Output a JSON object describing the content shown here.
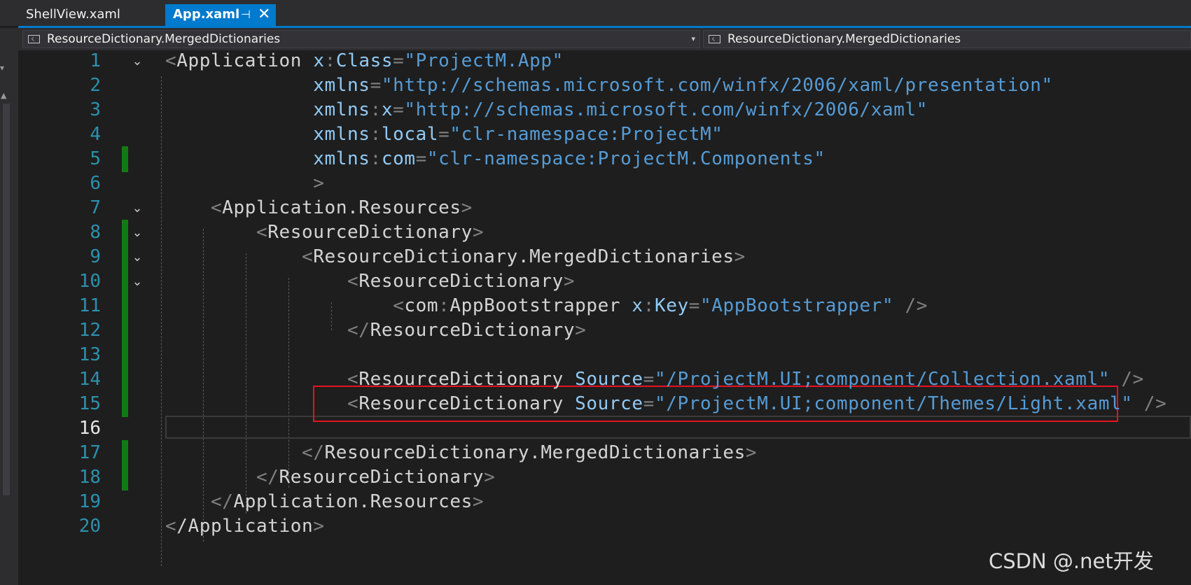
{
  "tabs": {
    "inactive_label": "ShellView.xaml",
    "active_label": "App.xaml",
    "pin_glyph": "⊣",
    "close_glyph": "✕"
  },
  "navbar": {
    "left_scope": "ResourceDictionary.MergedDictionaries",
    "right_scope": "ResourceDictionary.MergedDictionaries",
    "dropdown_glyph": "▾"
  },
  "editor": {
    "current_line": 16,
    "lines": [
      {
        "n": "1",
        "tokens": [
          [
            "br",
            "<"
          ],
          [
            "el",
            "Application "
          ],
          [
            "an",
            "x"
          ],
          [
            "op",
            ":"
          ],
          [
            "an",
            "Class"
          ],
          [
            "op",
            "="
          ],
          [
            "av",
            "\"ProjectM.App\""
          ]
        ]
      },
      {
        "n": "2",
        "tokens": [
          [
            "an",
            "             xmlns"
          ],
          [
            "op",
            "="
          ],
          [
            "av",
            "\"http://schemas.microsoft.com/winfx/2006/xaml/presentation\""
          ]
        ]
      },
      {
        "n": "3",
        "tokens": [
          [
            "an",
            "             xmlns"
          ],
          [
            "op",
            ":"
          ],
          [
            "an",
            "x"
          ],
          [
            "op",
            "="
          ],
          [
            "av",
            "\"http://schemas.microsoft.com/winfx/2006/xaml\""
          ]
        ]
      },
      {
        "n": "4",
        "tokens": [
          [
            "an",
            "             xmlns"
          ],
          [
            "op",
            ":"
          ],
          [
            "an",
            "local"
          ],
          [
            "op",
            "="
          ],
          [
            "av",
            "\"clr-namespace:ProjectM\""
          ]
        ]
      },
      {
        "n": "5",
        "tokens": [
          [
            "an",
            "             xmlns"
          ],
          [
            "op",
            ":"
          ],
          [
            "an",
            "com"
          ],
          [
            "op",
            "="
          ],
          [
            "av",
            "\"clr-namespace:ProjectM.Components\""
          ]
        ]
      },
      {
        "n": "6",
        "tokens": [
          [
            "br",
            "             >"
          ]
        ]
      },
      {
        "n": "7",
        "tokens": [
          [
            "br",
            "    <"
          ],
          [
            "el",
            "Application.Resources"
          ],
          [
            "br",
            ">"
          ]
        ]
      },
      {
        "n": "8",
        "tokens": [
          [
            "br",
            "        <"
          ],
          [
            "el",
            "ResourceDictionary"
          ],
          [
            "br",
            ">"
          ]
        ]
      },
      {
        "n": "9",
        "tokens": [
          [
            "br",
            "            <"
          ],
          [
            "el",
            "ResourceDictionary.MergedDictionaries"
          ],
          [
            "br",
            ">"
          ]
        ]
      },
      {
        "n": "10",
        "tokens": [
          [
            "br",
            "                <"
          ],
          [
            "el",
            "ResourceDictionary"
          ],
          [
            "br",
            ">"
          ]
        ]
      },
      {
        "n": "11",
        "tokens": [
          [
            "br",
            "                    <"
          ],
          [
            "el",
            "com"
          ],
          [
            "op",
            ":"
          ],
          [
            "el",
            "AppBootstrapper "
          ],
          [
            "an",
            "x"
          ],
          [
            "op",
            ":"
          ],
          [
            "an",
            "Key"
          ],
          [
            "op",
            "="
          ],
          [
            "av",
            "\"AppBootstrapper\""
          ],
          [
            "br",
            " />"
          ]
        ]
      },
      {
        "n": "12",
        "tokens": [
          [
            "br",
            "                </"
          ],
          [
            "el",
            "ResourceDictionary"
          ],
          [
            "br",
            ">"
          ]
        ]
      },
      {
        "n": "13",
        "tokens": []
      },
      {
        "n": "14",
        "tokens": [
          [
            "br",
            "                <"
          ],
          [
            "el",
            "ResourceDictionary "
          ],
          [
            "an",
            "Source"
          ],
          [
            "op",
            "="
          ],
          [
            "av",
            "\"/ProjectM.UI;component/Collection.xaml\""
          ],
          [
            "br",
            " />"
          ]
        ]
      },
      {
        "n": "15",
        "tokens": [
          [
            "br",
            "                <"
          ],
          [
            "el",
            "ResourceDictionary "
          ],
          [
            "an",
            "Source"
          ],
          [
            "op",
            "="
          ],
          [
            "av",
            "\"/ProjectM.UI;component/Themes/Light.xaml\""
          ],
          [
            "br",
            " />"
          ]
        ]
      },
      {
        "n": "16",
        "tokens": []
      },
      {
        "n": "17",
        "tokens": [
          [
            "br",
            "            </"
          ],
          [
            "el",
            "ResourceDictionary.MergedDictionaries"
          ],
          [
            "br",
            ">"
          ]
        ]
      },
      {
        "n": "18",
        "tokens": [
          [
            "br",
            "        </"
          ],
          [
            "el",
            "ResourceDictionary"
          ],
          [
            "br",
            ">"
          ]
        ]
      },
      {
        "n": "19",
        "tokens": [
          [
            "br",
            "    </"
          ],
          [
            "el",
            "Application.Resources"
          ],
          [
            "br",
            ">"
          ]
        ]
      },
      {
        "n": "20",
        "tokens": [
          [
            "br",
            "<"
          ],
          [
            "el",
            "/Application"
          ],
          [
            "br",
            ">"
          ]
        ]
      }
    ]
  },
  "watermark": "CSDN @.net开发",
  "colors": {
    "accent": "#007acc",
    "change_marker": "#107c10",
    "highlight_box": "#e81123",
    "line_number": "#2b91af"
  }
}
